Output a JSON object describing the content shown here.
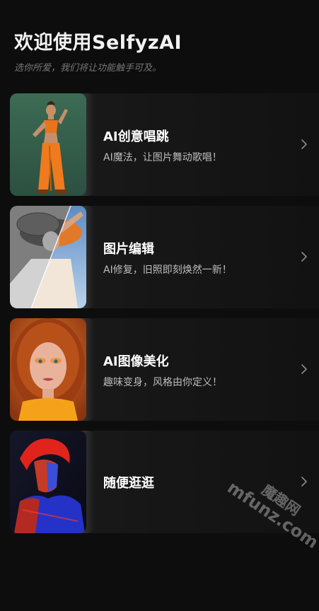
{
  "header": {
    "title": "欢迎使用SelfyzAI",
    "subtitle": "选你所爱，我们将让功能触手可及。"
  },
  "cards": [
    {
      "title": "AI创意唱跳",
      "description": "AI魔法，让图片舞动歌唱！",
      "thumbnail_icon": "dancer-photo",
      "accent": "#e8741c"
    },
    {
      "title": "图片编辑",
      "description": "AI修复，旧照即刻焕然一新！",
      "thumbnail_icon": "restored-photo",
      "accent": "#e07a2a"
    },
    {
      "title": "AI图像美化",
      "description": "趣味变身，风格由你定义！",
      "thumbnail_icon": "portrait-photo",
      "accent": "#d9651e"
    },
    {
      "title": "随便逛逛",
      "description": "",
      "thumbnail_icon": "neon-portrait-photo",
      "accent": "#1f3cff"
    }
  ],
  "watermark": {
    "cn": "魔趣网",
    "en": "mfunz.com"
  },
  "colors": {
    "background": "#0d0d0d",
    "card": "#181818",
    "subtitle": "#777777",
    "desc": "#bdbdbd"
  }
}
